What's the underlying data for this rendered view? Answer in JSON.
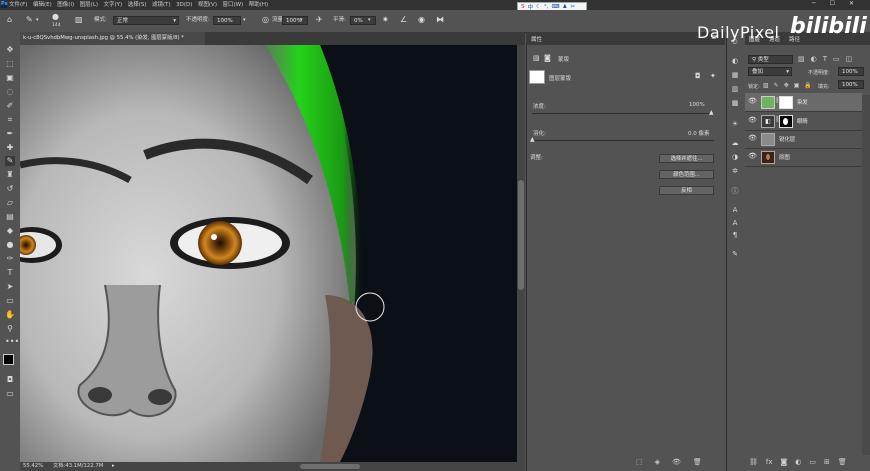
{
  "menubar": {
    "items": [
      "文件(F)",
      "编辑(E)",
      "图像(I)",
      "图层(L)",
      "文字(Y)",
      "选择(S)",
      "滤镜(T)",
      "3D(D)",
      "视图(V)",
      "窗口(W)",
      "帮助(H)"
    ],
    "ime_label": "中"
  },
  "options": {
    "brush_size": "144",
    "mode_label": "模式:",
    "mode_value": "正常",
    "opacity_label": "不透明度:",
    "opacity_value": "100%",
    "flow_label": "流量:",
    "flow_value": "100%",
    "smooth_label": "平滑:",
    "smooth_value": "0%"
  },
  "document": {
    "tab_title": "k-u-c8QSvhdbMwg-unsplash.jpg @ 55.4% (染发, 图层蒙版/8) *",
    "zoom": "55.42%",
    "doc_info": "文档:43.1M/122.7M"
  },
  "properties": {
    "panel_title": "属性",
    "subtitle": "蒙版",
    "mask_label": "图层蒙版",
    "density_label": "浓度:",
    "density_value": "100%",
    "feather_label": "羽化:",
    "feather_value": "0.0 像素",
    "adjust_label": "调整:",
    "btn_select_mask": "选择并遮住...",
    "btn_color_range": "颜色范围...",
    "btn_invert": "反相"
  },
  "layers": {
    "tabs": [
      "图层",
      "通道",
      "路径"
    ],
    "filter_value": "类型",
    "blend_value": "叠加",
    "opacity_label": "不透明度:",
    "opacity_value": "100%",
    "lock_label": "锁定:",
    "fill_label": "填充:",
    "fill_value": "100%",
    "items": [
      {
        "name": "染发",
        "selected": true
      },
      {
        "name": "眼睛",
        "selected": false
      },
      {
        "name": "锐化层",
        "selected": false
      },
      {
        "name": "原图",
        "selected": false
      }
    ]
  },
  "watermark": {
    "dailypixel": "DailyPixel",
    "bilibili": "bilibili"
  },
  "colors": {
    "app_bg": "#535353",
    "menubar_bg": "#323232",
    "hair_green": "#1fd11a",
    "selected_layer": "#6a6a6a"
  }
}
